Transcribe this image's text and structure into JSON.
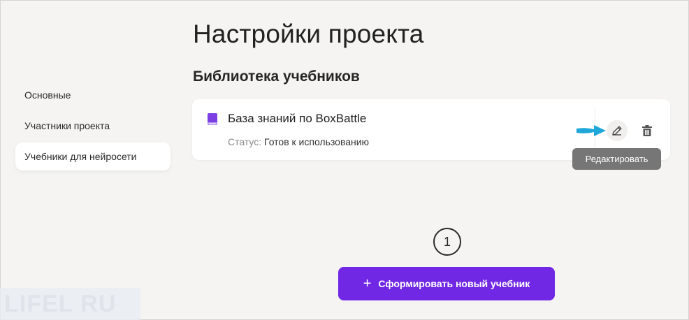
{
  "page": {
    "title": "Настройки проекта",
    "section_title": "Библиотека учебников"
  },
  "sidebar": {
    "items": [
      {
        "label": "Основные",
        "active": false
      },
      {
        "label": "Участники проекта",
        "active": false
      },
      {
        "label": "Учебники для нейросети",
        "active": true
      }
    ]
  },
  "card": {
    "title": "База знаний по BoxBattle",
    "status_label": "Статус:",
    "status_value": "Готов к использованию",
    "icon": "book-icon",
    "actions": {
      "edit_icon": "pencil-icon",
      "delete_icon": "trash-icon"
    }
  },
  "tooltip": {
    "text": "Редактировать"
  },
  "annotation": {
    "step_number": "1",
    "arrow_color": "#1ea7d8"
  },
  "primary_button": {
    "icon": "plus",
    "label": "Сформировать новый учебник"
  },
  "watermark": {
    "text": "LIFEL RU"
  },
  "colors": {
    "accent": "#7028e4",
    "book_icon": "#7b3fe4",
    "tooltip_bg": "#767676",
    "background": "#f5f4f2"
  }
}
